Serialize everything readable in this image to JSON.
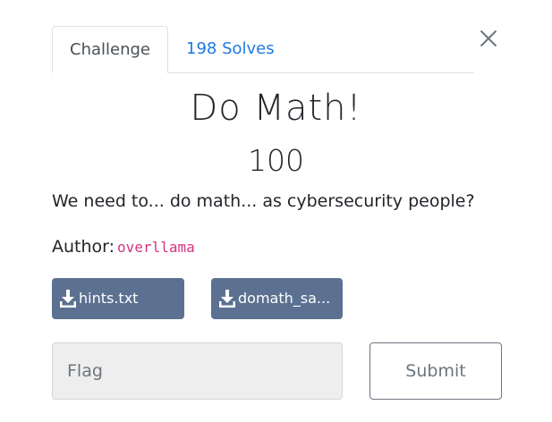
{
  "tabs": [
    {
      "label": "Challenge",
      "active": true
    },
    {
      "label": "198 Solves",
      "active": false
    }
  ],
  "challenge": {
    "name": "Do Math!",
    "points": "100",
    "description": "We need to... do math... as cybersecurity people?",
    "author_label": "Author:",
    "author_name": "overllama"
  },
  "files": [
    {
      "label": "hints.txt",
      "icon": "download-icon"
    },
    {
      "label": "domath_sa...",
      "icon": "download-icon"
    }
  ],
  "form": {
    "flag_placeholder": "Flag",
    "flag_value": "",
    "submit_label": "Submit"
  },
  "colors": {
    "accent": "#1f7ae0",
    "file_button": "#5c7191",
    "author_code": "#d63384"
  }
}
